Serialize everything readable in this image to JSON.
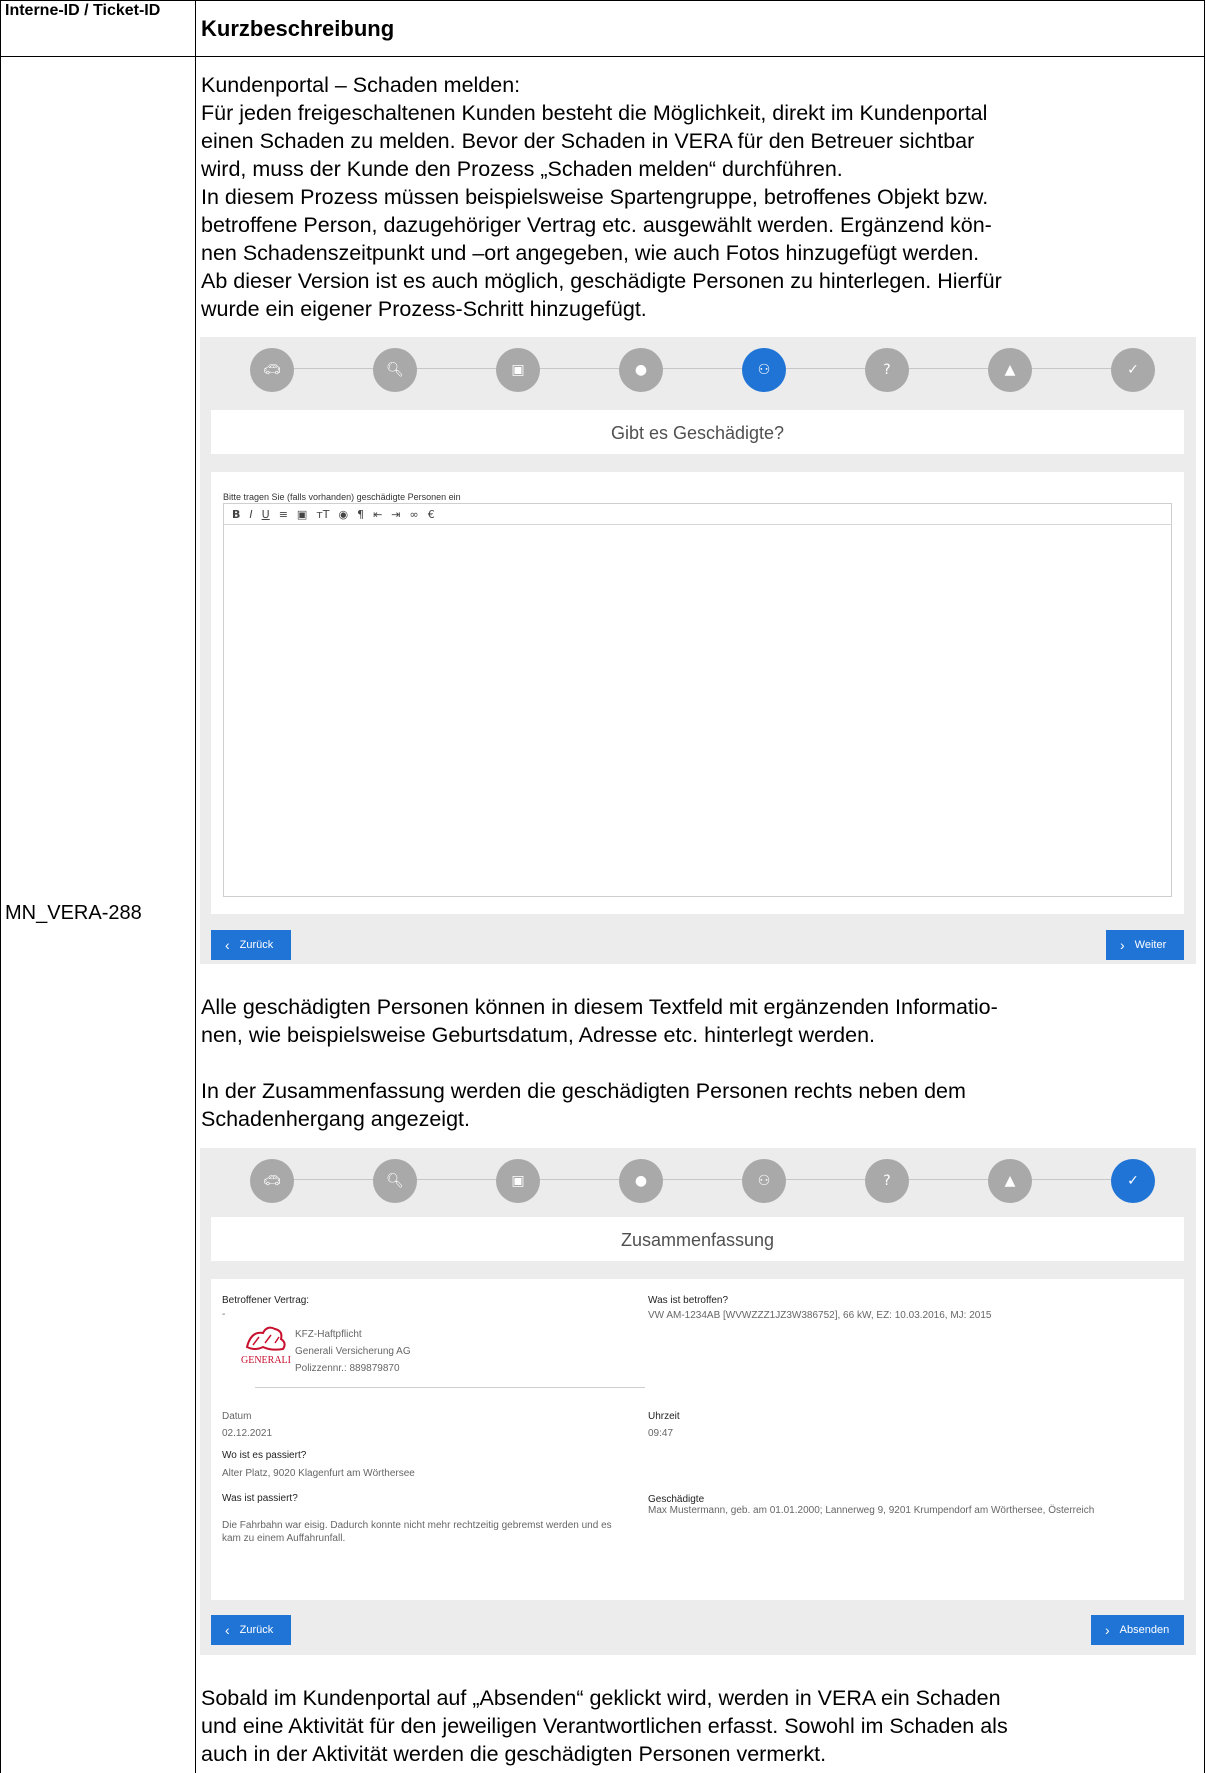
{
  "table": {
    "col1_header": "Interne-ID / Ticket-ID",
    "col2_header": "Kurzbeschreibung",
    "ticket_id": "MN_VERA-288"
  },
  "paragraphs": {
    "intro": "Kundenportal – Schaden melden:\nFür jeden freigeschaltenen Kunden besteht die Möglichkeit, direkt im Kundenportal\neinen Schaden zu melden. Bevor der Schaden in VERA für den Betreuer sichtbar\nwird, muss der Kunde den Prozess „Schaden melden“ durchführen.\nIn diesem Prozess müssen beispielsweise Spartengruppe, betroffenes Objekt bzw.\nbetroffene Person, dazugehöriger Vertrag etc. ausgewählt werden. Ergänzend kön-\nnen Schadenszeitpunkt und –ort angegeben, wie auch Fotos hinzugefügt werden.\nAb dieser Version ist es auch möglich, geschädigte Personen zu hinterlegen. Hierfür\nwurde ein eigener Prozess-Schritt hinzugefügt.",
    "middle": "Alle geschädigten Personen können in diesem Textfeld mit ergänzenden Informatio-\nnen, wie beispielsweise Geburtsdatum, Adresse etc. hinterlegt werden.\n\nIn der Zusammenfassung werden die geschädigten Personen rechts neben dem\nSchadenhergang angezeigt.",
    "end": "Sobald im Kundenportal auf „Absenden“ geklickt wird, werden in VERA ein Schaden\nund eine Aktivität für den jeweiligen Verantwortlichen erfasst. Sowohl im Schaden als\nauch in der Aktivität werden die geschädigten Personen vermerkt."
  },
  "steps_icons": [
    "car-icon",
    "search-doc-icon",
    "calendar-icon",
    "location-pin-icon",
    "people-icon",
    "question-icon",
    "image-icon",
    "check-icon"
  ],
  "screen1": {
    "active_step": 4,
    "title": "Gibt es Geschädigte?",
    "editor_label": "Bitte tragen Sie (falls vorhanden) geschädigte Personen ein",
    "back_label": "Zurück",
    "next_label": "Weiter"
  },
  "screen2": {
    "active_step": 7,
    "title": "Zusammenfassung",
    "contract_label": "Betroffener Vertrag:",
    "contract_dash": "-",
    "logo_text": "GENERALI",
    "contract_type": "KFZ-Haftpflicht",
    "insurer": "Generali Versicherung AG",
    "policy": "Polizzennr.: 889879870",
    "affected_label": "Was ist betroffen?",
    "affected_value": "VW AM-1234AB [WVWZZZ1JZ3W386752], 66 kW, EZ: 10.03.2016, MJ: 2015",
    "date_label": "Datum",
    "date_value": "02.12.2021",
    "time_label": "Uhrzeit",
    "time_value": "09:47",
    "where_label": "Wo ist es passiert?",
    "where_value": "Alter Platz, 9020 Klagenfurt am Wörthersee",
    "what_label": "Was ist passiert?",
    "what_value": "Die Fahrbahn war eisig. Dadurch konnte nicht mehr rechtzeitig gebremst werden und es kam zu einem Auffahrunfall.",
    "injured_label": "Geschädigte",
    "injured_value": "Max Mustermann, geb. am 01.01.2000; Lannerweg 9, 9201 Krumpendorf am Wörthersee, Österreich",
    "back_label": "Zurück",
    "submit_label": "Absenden"
  },
  "colors": {
    "accent": "#1f74d6",
    "step_inactive": "#a9a9a9",
    "panel_bg": "#ececec",
    "logo_red": "#c8102e"
  }
}
